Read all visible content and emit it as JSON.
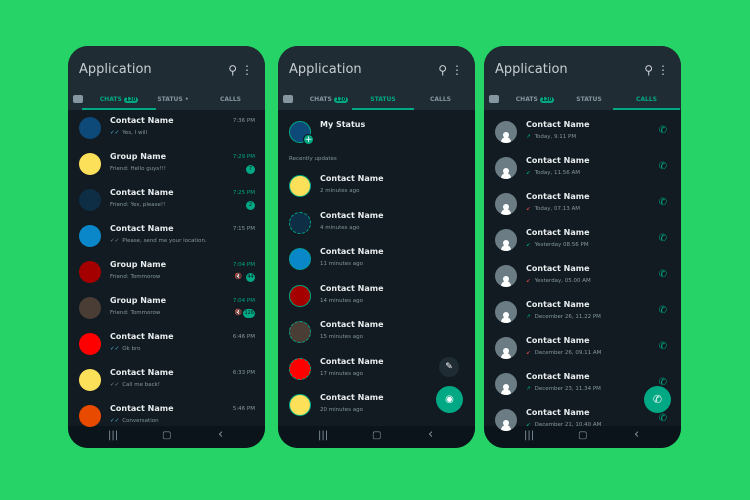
{
  "colors": {
    "background": "#25d366",
    "accent": "#00a884",
    "dark": "#111b21",
    "header": "#1f2c34"
  },
  "app_title": "Application",
  "tabs": {
    "chats": "CHATS",
    "chats_badge": "120",
    "status": "STATUS",
    "status_dot": "•",
    "calls": "CALLS"
  },
  "icons": {
    "search": "search-icon",
    "menu": "more-vert-icon",
    "camera": "camera-icon"
  },
  "nav": {
    "recents": "|||",
    "home": "▢",
    "back": "‹"
  },
  "chats": [
    {
      "name": "Contact Name",
      "msg": "Yes, I will",
      "time": "7:36 PM",
      "color": "#0d4a7a",
      "tick": true,
      "read": true
    },
    {
      "name": "Group Name",
      "msg": "Friend: Hello guys!!!",
      "time": "7:29 PM",
      "color": "#fde05a",
      "unread": "7"
    },
    {
      "name": "Contact Name",
      "msg": "Friend: Yes, please!!",
      "time": "7:25 PM",
      "color": "#0d2e45",
      "unread": "2"
    },
    {
      "name": "Contact Name",
      "msg": "Please, send me your location.",
      "time": "7:15 PM",
      "color": "#0a87c8",
      "tick": true
    },
    {
      "name": "Group Name",
      "msg": "Friend: Tommorow",
      "time": "7:04 PM",
      "color": "#a50000",
      "unread": "44",
      "muted": true
    },
    {
      "name": "Group Name",
      "msg": "Friend: Tommorow",
      "time": "7:04 PM",
      "color": "#4a3d35",
      "unread": "126",
      "muted": true
    },
    {
      "name": "Contact Name",
      "msg": "Ok bro",
      "time": "6:46 PM",
      "color": "#ff0000",
      "tick": true,
      "read": true
    },
    {
      "name": "Contact Name",
      "msg": "Call me back!",
      "time": "6:33 PM",
      "color": "#fde05a",
      "tick": true
    },
    {
      "name": "Contact Name",
      "msg": "Conversation",
      "time": "5:46 PM",
      "color": "#e84a00",
      "tick": true,
      "read": true
    }
  ],
  "status": {
    "my_status": "My Status",
    "section": "Recently updates",
    "items": [
      {
        "name": "Contact Name",
        "time": "2 minutes ago",
        "color": "#fde05a",
        "seen": false
      },
      {
        "name": "Contact Name",
        "time": "4 minutes ago",
        "color": "#0d2e45",
        "seen": true
      },
      {
        "name": "Contact Name",
        "time": "11 minutes ago",
        "color": "#0a87c8",
        "seen": true
      },
      {
        "name": "Contact Name",
        "time": "14 minutes ago",
        "color": "#a50000",
        "seen": false
      },
      {
        "name": "Contact Name",
        "time": "15 minutes ago",
        "color": "#4a3d35",
        "seen": true
      },
      {
        "name": "Contact Name",
        "time": "17 minutes ago",
        "color": "#ff0000",
        "seen": true
      },
      {
        "name": "Contact Name",
        "time": "20 minutes ago",
        "color": "#fde05a",
        "seen": false
      }
    ]
  },
  "calls": [
    {
      "name": "Contact Name",
      "time": "Today, 9.11 PM",
      "dir": "out"
    },
    {
      "name": "Contact Name",
      "time": "Today, 11.56 AM",
      "dir": "in"
    },
    {
      "name": "Contact Name",
      "time": "Today, 07.13 AM",
      "dir": "missed"
    },
    {
      "name": "Contact Name",
      "time": "Yesterday 08.56 PM",
      "dir": "in"
    },
    {
      "name": "Contact Name",
      "time": "Yesterday, 05.00 AM",
      "dir": "missed"
    },
    {
      "name": "Contact Name",
      "time": "December 26, 11.22 PM",
      "dir": "out"
    },
    {
      "name": "Contact Name",
      "time": "December 26, 09.11 AM",
      "dir": "missed"
    },
    {
      "name": "Contact Name",
      "time": "December 23, 11.34 PM",
      "dir": "out"
    },
    {
      "name": "Contact Name",
      "time": "December 21, 10.40 AM",
      "dir": "in"
    }
  ]
}
